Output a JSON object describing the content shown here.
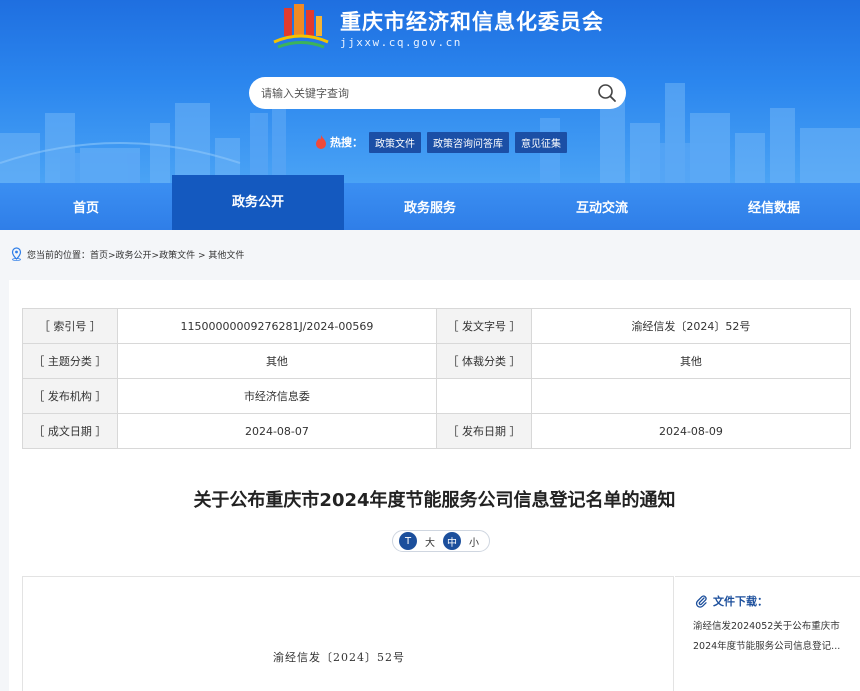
{
  "header": {
    "site_title": "重庆市经济和信息化委员会",
    "site_url": "jjxxw.cq.gov.cn"
  },
  "search": {
    "placeholder": "请输入关键字查询"
  },
  "hot": {
    "label": "热搜：",
    "tags": [
      "政策文件",
      "政策咨询问答库",
      "意见征集"
    ]
  },
  "nav": {
    "items": [
      "首页",
      "政务公开",
      "政务服务",
      "互动交流",
      "经信数据"
    ],
    "active_index": 1
  },
  "breadcrumb": {
    "prefix": "您当前的位置：",
    "path": "首页>政务公开>政策文件 > 其他文件"
  },
  "meta": {
    "rows": [
      {
        "k1": "［ 索引号 ］",
        "v1": "11500000009276281J/2024-00569",
        "k2": "［ 发文字号 ］",
        "v2": "渝经信发〔2024〕52号"
      },
      {
        "k1": "［ 主题分类 ］",
        "v1": "其他",
        "k2": "［ 体裁分类 ］",
        "v2": "其他"
      },
      {
        "k1": "［ 发布机构 ］",
        "v1": "市经济信息委",
        "k2": "",
        "v2": ""
      },
      {
        "k1": "［ 成文日期 ］",
        "v1": "2024-08-07",
        "k2": "［ 发布日期 ］",
        "v2": "2024-08-09"
      }
    ]
  },
  "article": {
    "title": "关于公布重庆市2024年度节能服务公司信息登记名单的通知",
    "doc_no": "渝经信发〔2024〕52号"
  },
  "fontsize": {
    "options": [
      "T",
      "大",
      "中",
      "小"
    ]
  },
  "download": {
    "heading": "文件下载：",
    "link_line1": "渝经信发2024052关于公布重庆市",
    "link_line2": "2024年度节能服务公司信息登记..."
  },
  "colors": {
    "brand_blue": "#2f7ee8",
    "nav_active": "#1459bf",
    "tag_bg": "#1b4fa6"
  }
}
